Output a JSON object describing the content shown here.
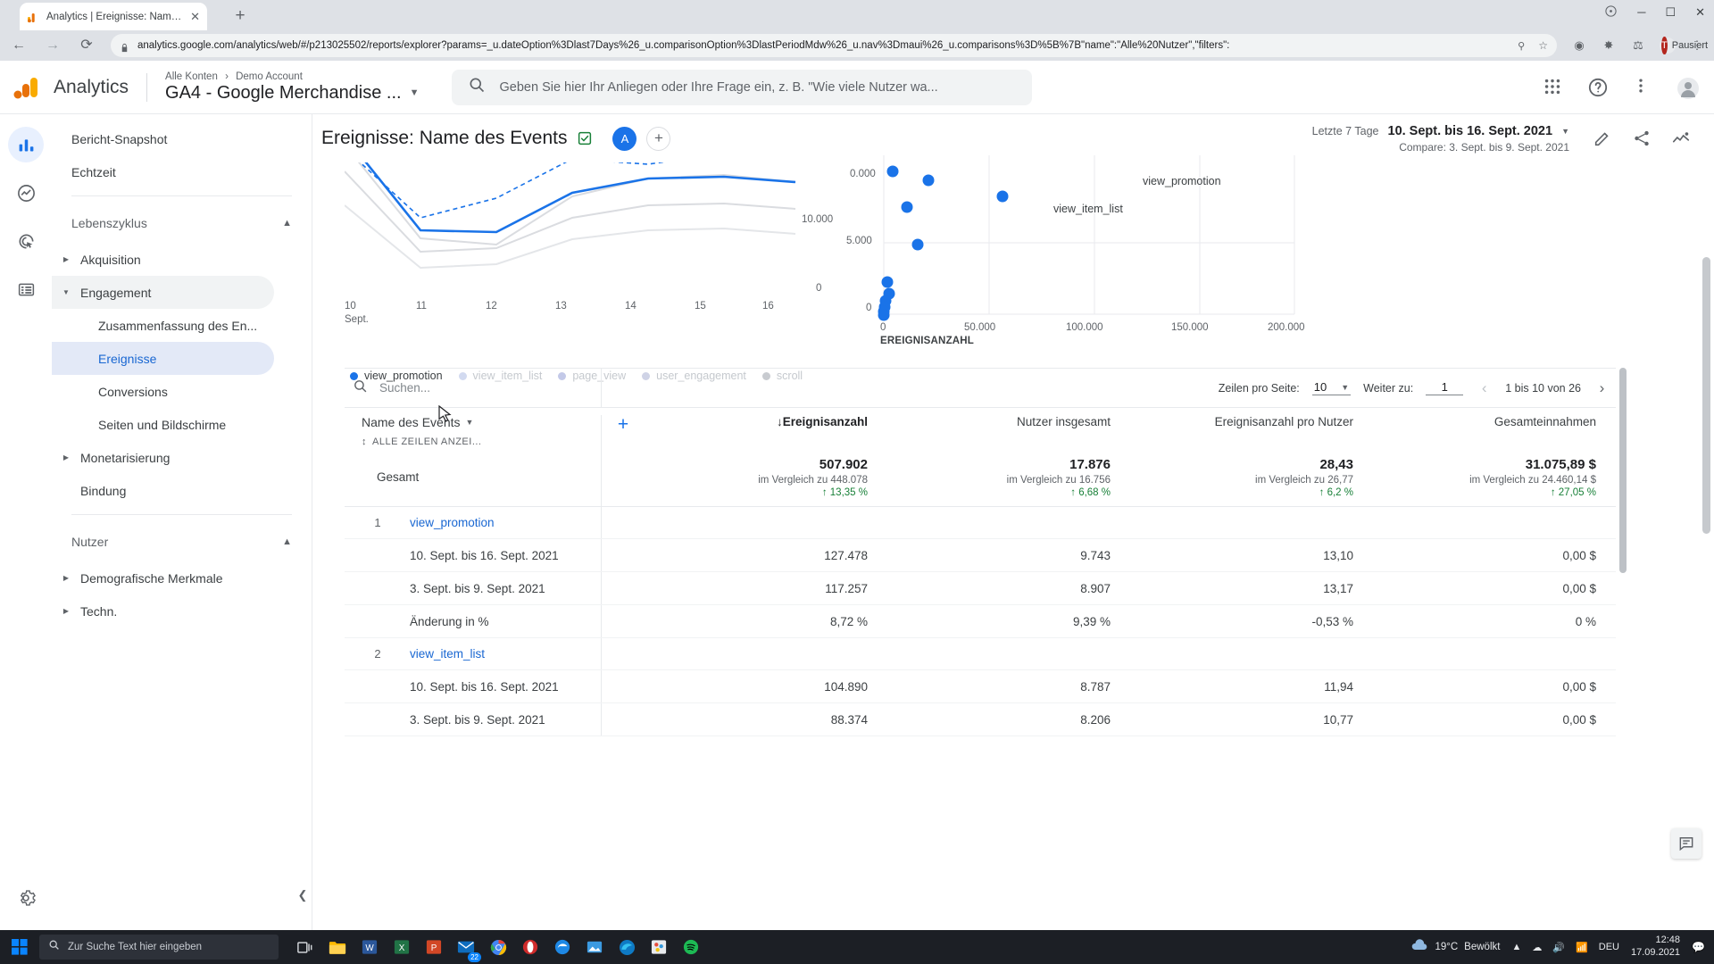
{
  "browser": {
    "tab": {
      "title": "Analytics | Ereignisse: Name des ",
      "close": "✕"
    },
    "newtab_label": "+",
    "url": "analytics.google.com/analytics/web/#/p213025502/reports/explorer?params=_u.dateOption%3Dlast7Days%26_u.comparisonOption%3DlastPeriodMdw%26_u.nav%3Dmaui%26_u.comparisons%3D%5B%7B\"name\":\"Alle%20Nutzer\",\"filters\":",
    "profile_label": "Pausiert",
    "profile_initial": "T",
    "window_minimize": "─",
    "window_maximize": "☐",
    "window_close": "✕"
  },
  "ga_header": {
    "brand": "Analytics",
    "breadcrumb_root": "Alle Konten",
    "breadcrumb_sep": "›",
    "breadcrumb_account": "Demo Account",
    "property": "GA4 - Google Merchandise ...",
    "search_placeholder": "Geben Sie hier Ihr Anliegen oder Ihre Frage ein, z. B. \"Wie viele Nutzer wa..."
  },
  "sidebar": {
    "items": [
      {
        "label": "Bericht-Snapshot",
        "type": "plain"
      },
      {
        "label": "Echtzeit",
        "type": "plain"
      }
    ],
    "section_lifecycle": "Lebenszyklus",
    "lifecycle": [
      {
        "label": "Akquisition",
        "type": "parent",
        "expanded": false
      },
      {
        "label": "Engagement",
        "type": "parent",
        "expanded": true,
        "selected": true
      },
      {
        "label": "Zusammenfassung des En...",
        "type": "child"
      },
      {
        "label": "Ereignisse",
        "type": "child",
        "active": true
      },
      {
        "label": "Conversions",
        "type": "child"
      },
      {
        "label": "Seiten und Bildschirme",
        "type": "child"
      },
      {
        "label": "Monetarisierung",
        "type": "parent",
        "expanded": false
      },
      {
        "label": "Bindung",
        "type": "parent-noarrow"
      }
    ],
    "section_users": "Nutzer",
    "users": [
      {
        "label": "Demografische Merkmale",
        "type": "parent",
        "expanded": false
      },
      {
        "label": "Techn.",
        "type": "parent",
        "expanded": false
      }
    ]
  },
  "report": {
    "title": "Ereignisse: Name des Events",
    "chip_a": "A",
    "chip_plus": "+",
    "date_prefix": "Letzte 7 Tage",
    "date_range": "10. Sept. bis 16. Sept. 2021",
    "compare_text": "Compare: 3. Sept. bis 9. Sept. 2021"
  },
  "chart_data": [
    {
      "type": "line",
      "title": "",
      "xlabel": "Sept.",
      "ylabel": "",
      "x": [
        "10",
        "11",
        "12",
        "13",
        "14",
        "15",
        "16"
      ],
      "ytick_labels": [
        "10.000",
        "0"
      ],
      "ylim": [
        0,
        22000
      ],
      "legend": [
        {
          "name": "view_promotion",
          "color": "#1a73e8",
          "active": true
        },
        {
          "name": "view_item_list",
          "color": "#d2daf0",
          "active": false
        },
        {
          "name": "page_view",
          "color": "#c3c9e8",
          "active": false
        },
        {
          "name": "user_engagement",
          "color": "#cfd3e6",
          "active": false
        },
        {
          "name": "scroll",
          "color": "#c8cbd0",
          "active": false
        }
      ],
      "series": [
        {
          "name": "view_promotion",
          "color": "#1a73e8",
          "values": [
            21500,
            9000,
            8900,
            15500,
            17800,
            18000,
            17400
          ]
        },
        {
          "name": "view_promotion_compare",
          "color": "#1a73e8",
          "dashed": true,
          "values": [
            21000,
            10500,
            13500,
            19800,
            18800,
            20200,
            19600
          ]
        },
        {
          "name": "view_item_list",
          "color": "#dadce0",
          "values": [
            11800,
            8000,
            8200,
            11000,
            12400,
            12600,
            12200
          ]
        },
        {
          "name": "page_view",
          "color": "#dadce0",
          "values": [
            10000,
            7000,
            7400,
            9600,
            10600,
            10700,
            10300
          ]
        },
        {
          "name": "user_engagement",
          "color": "#e2e4e7",
          "values": [
            8200,
            5600,
            5800,
            7600,
            8400,
            8500,
            8200
          ]
        }
      ]
    },
    {
      "type": "scatter",
      "title": "EREIGNISANZAHL",
      "xlabel": "EREIGNISANZAHL",
      "ylabel": "",
      "xtick_labels": [
        "0",
        "50.000",
        "100.000",
        "150.000",
        "200.000"
      ],
      "ytick_labels": [
        "0",
        "5.000",
        "0.000"
      ],
      "xlim": [
        0,
        200000
      ],
      "ylim": [
        0,
        11500
      ],
      "point_color": "#1a73e8",
      "annotations": [
        {
          "text": "view_promotion",
          "x": 128000,
          "y": 9900
        },
        {
          "text": "view_item_list",
          "x": 105000,
          "y": 8400
        }
      ],
      "points": [
        {
          "x": 4000,
          "y": 11200
        },
        {
          "x": 18000,
          "y": 10600
        },
        {
          "x": 52000,
          "y": 9500
        },
        {
          "x": 8000,
          "y": 8500
        },
        {
          "x": 16000,
          "y": 6200
        },
        {
          "x": 2500,
          "y": 4000
        },
        {
          "x": 3200,
          "y": 2600
        },
        {
          "x": 1200,
          "y": 1500
        },
        {
          "x": 900,
          "y": 900
        },
        {
          "x": 700,
          "y": 500
        },
        {
          "x": 600,
          "y": 260
        },
        {
          "x": 500,
          "y": 120
        }
      ]
    }
  ],
  "table": {
    "search_placeholder": "Suchen...",
    "rows_per_page_label": "Zeilen pro Seite:",
    "rows_per_page_value": "10",
    "goto_label": "Weiter zu:",
    "goto_value": "1",
    "page_range": "1 bis 10 von 26",
    "prev_icon": "‹",
    "next_icon": "›",
    "dimension_header": "Name des Events",
    "all_rows_label": "ALLE ZEILEN ANZEI...",
    "add_column_label": "+",
    "metric_headers": [
      {
        "label": "Ereignisanzahl",
        "sorted": true,
        "sort_arrow": "↓"
      },
      {
        "label": "Nutzer insgesamt",
        "sorted": false
      },
      {
        "label": "Ereignisanzahl pro Nutzer",
        "sorted": false
      },
      {
        "label": "Gesamteinnahmen",
        "sorted": false
      }
    ],
    "total_row": {
      "label": "Gesamt",
      "cells": [
        {
          "value": "507.902",
          "compare": "im Vergleich zu 448.078",
          "delta": "↑ 13,35 %"
        },
        {
          "value": "17.876",
          "compare": "im Vergleich zu 16.756",
          "delta": "↑ 6,68 %"
        },
        {
          "value": "28,43",
          "compare": "im Vergleich zu 26,77",
          "delta": "↑ 6,2 %"
        },
        {
          "value": "31.075,89 $",
          "compare": "im Vergleich zu 24.460,14 $",
          "delta": "↑ 27,05 %"
        }
      ]
    },
    "rows": [
      {
        "index": "1",
        "name": "view_promotion",
        "periods": [
          {
            "label": "10. Sept. bis 16. Sept. 2021",
            "values": [
              "127.478",
              "9.743",
              "13,10",
              "0,00 $"
            ]
          },
          {
            "label": "3. Sept. bis 9. Sept. 2021",
            "values": [
              "117.257",
              "8.907",
              "13,17",
              "0,00 $"
            ]
          },
          {
            "label": "Änderung in %",
            "values": [
              "8,72 %",
              "9,39 %",
              "-0,53 %",
              "0 %"
            ]
          }
        ]
      },
      {
        "index": "2",
        "name": "view_item_list",
        "periods": [
          {
            "label": "10. Sept. bis 16. Sept. 2021",
            "values": [
              "104.890",
              "8.787",
              "11,94",
              "0,00 $"
            ]
          },
          {
            "label": "3. Sept. bis 9. Sept. 2021",
            "values": [
              "88.374",
              "8.206",
              "10,77",
              "0,00 $"
            ]
          }
        ]
      }
    ]
  },
  "taskbar": {
    "search_placeholder": "Zur Suche Text hier eingeben",
    "weather_temp": "19°C",
    "weather_desc": "Bewölkt",
    "lang": "DEU",
    "time": "12:48",
    "date": "17.09.2021",
    "mail_badge": "22"
  }
}
